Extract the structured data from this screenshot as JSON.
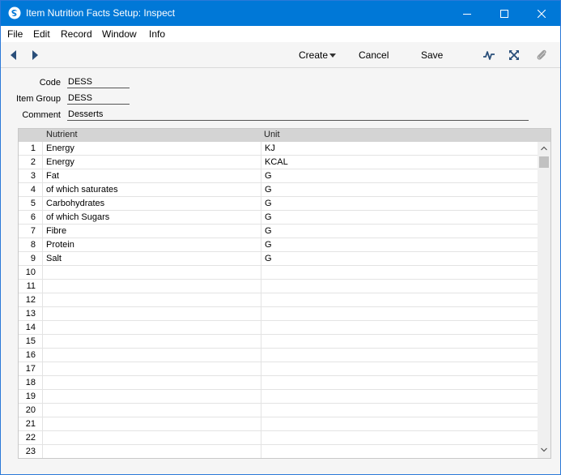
{
  "window": {
    "title": "Item Nutrition Facts Setup: Inspect",
    "title_bar_color": "#0078d7"
  },
  "menu": {
    "items": [
      "File",
      "Edit",
      "Record",
      "Window",
      "Info"
    ]
  },
  "toolbar": {
    "create_label": "Create",
    "cancel_label": "Cancel",
    "save_label": "Save"
  },
  "form": {
    "code_label": "Code",
    "code_value": "DESS",
    "item_group_label": "Item Group",
    "item_group_value": "DESS",
    "comment_label": "Comment",
    "comment_value": "Desserts"
  },
  "table": {
    "columns": [
      "Nutrient",
      "Unit"
    ],
    "rows": [
      {
        "num": "1",
        "nutrient": "Energy",
        "unit": "KJ"
      },
      {
        "num": "2",
        "nutrient": "Energy",
        "unit": "KCAL"
      },
      {
        "num": "3",
        "nutrient": "Fat",
        "unit": "G"
      },
      {
        "num": "4",
        "nutrient": "of which saturates",
        "unit": "G"
      },
      {
        "num": "5",
        "nutrient": "Carbohydrates",
        "unit": "G"
      },
      {
        "num": "6",
        "nutrient": "of which Sugars",
        "unit": "G"
      },
      {
        "num": "7",
        "nutrient": "Fibre",
        "unit": "G"
      },
      {
        "num": "8",
        "nutrient": "Protein",
        "unit": "G"
      },
      {
        "num": "9",
        "nutrient": "Salt",
        "unit": "G"
      },
      {
        "num": "10",
        "nutrient": "",
        "unit": ""
      },
      {
        "num": "11",
        "nutrient": "",
        "unit": ""
      },
      {
        "num": "12",
        "nutrient": "",
        "unit": ""
      },
      {
        "num": "13",
        "nutrient": "",
        "unit": ""
      },
      {
        "num": "14",
        "nutrient": "",
        "unit": ""
      },
      {
        "num": "15",
        "nutrient": "",
        "unit": ""
      },
      {
        "num": "16",
        "nutrient": "",
        "unit": ""
      },
      {
        "num": "17",
        "nutrient": "",
        "unit": ""
      },
      {
        "num": "18",
        "nutrient": "",
        "unit": ""
      },
      {
        "num": "19",
        "nutrient": "",
        "unit": ""
      },
      {
        "num": "20",
        "nutrient": "",
        "unit": ""
      },
      {
        "num": "21",
        "nutrient": "",
        "unit": ""
      },
      {
        "num": "22",
        "nutrient": "",
        "unit": ""
      },
      {
        "num": "23",
        "nutrient": "",
        "unit": ""
      }
    ]
  },
  "icons": {
    "app": "app-logo-icon",
    "minimize": "minimize-icon",
    "maximize": "maximize-icon",
    "close": "close-icon",
    "back": "arrow-left-icon",
    "forward": "arrow-right-icon",
    "activity": "activity-icon",
    "fullscreen": "expand-icon",
    "attach": "paperclip-icon"
  }
}
